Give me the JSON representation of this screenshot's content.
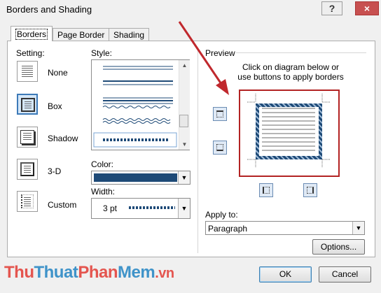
{
  "window": {
    "title": "Borders and Shading",
    "close_icon": "×"
  },
  "tabs": [
    {
      "label": "Borders",
      "active": true
    },
    {
      "label": "Page Border",
      "active": false
    },
    {
      "label": "Shading",
      "active": false
    }
  ],
  "setting": {
    "label": "Setting:",
    "items": [
      {
        "label": "None",
        "selected": false
      },
      {
        "label": "Box",
        "selected": true
      },
      {
        "label": "Shadow",
        "selected": false
      },
      {
        "label": "3-D",
        "selected": false
      },
      {
        "label": "Custom",
        "selected": false
      }
    ]
  },
  "style": {
    "label": "Style:"
  },
  "color": {
    "label": "Color:",
    "value": "#1e4a77"
  },
  "width": {
    "label": "Width:",
    "value": "3 pt"
  },
  "preview": {
    "label": "Preview",
    "instruction_line1": "Click on diagram below or",
    "instruction_line2": "use buttons to apply borders"
  },
  "apply_to": {
    "label": "Apply to:",
    "value": "Paragraph"
  },
  "buttons": {
    "options": "Options...",
    "ok": "OK",
    "cancel": "Cancel"
  },
  "watermark": {
    "part1": "Thu",
    "part2": "Thuat",
    "part3": "Phan",
    "part4": "Mem",
    "part5": ".vn"
  },
  "colors": {
    "accent": "#1e4a77",
    "highlight": "#b32323",
    "arrow": "#c0282d"
  }
}
